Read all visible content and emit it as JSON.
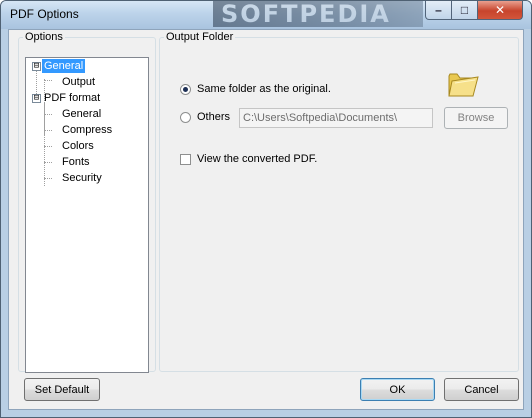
{
  "window": {
    "title": "PDF Options",
    "watermark": "SOFTPEDIA"
  },
  "caption_buttons": {
    "minimize": "–",
    "maximize": "□",
    "close": "✕"
  },
  "options": {
    "legend": "Options",
    "tree": {
      "general": "General",
      "output": "Output",
      "pdf_format": "PDF format",
      "pdf_general": "General",
      "compress": "Compress",
      "colors": "Colors",
      "fonts": "Fonts",
      "security": "Security"
    },
    "selected": "General"
  },
  "output_folder": {
    "legend": "Output Folder",
    "same_folder_label": "Same folder as the original.",
    "others_label": "Others",
    "path_value": "C:\\Users\\Softpedia\\Documents\\",
    "browse_label": "Browse",
    "view_converted_label": "View the converted PDF.",
    "same_folder_selected": true,
    "view_converted_checked": false
  },
  "footer": {
    "set_default_label": "Set Default",
    "ok_label": "OK",
    "cancel_label": "Cancel"
  },
  "icons": {
    "folder": "folder-icon",
    "expander_minus": "⊟"
  },
  "colors": {
    "selection": "#3399ff",
    "titlebar": "#bcd3ea",
    "close_button": "#c7442c"
  }
}
